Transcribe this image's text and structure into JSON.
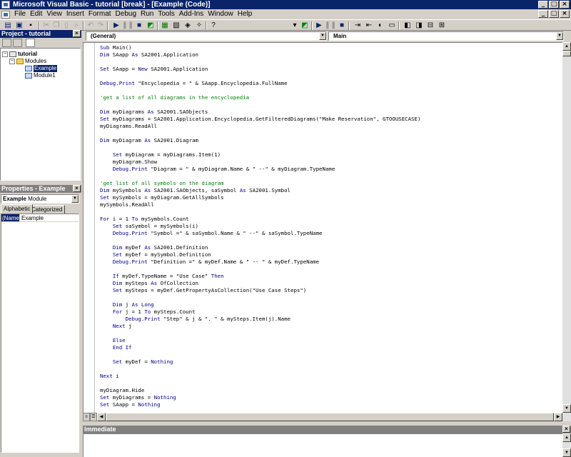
{
  "window": {
    "title": "Microsoft Visual Basic - tutorial [break] - [Example (Code)]",
    "controls": {
      "minimize": "_",
      "restore": "□",
      "close": "×"
    }
  },
  "menu": [
    "File",
    "Edit",
    "View",
    "Insert",
    "Format",
    "Debug",
    "Run",
    "Tools",
    "Add-Ins",
    "Window",
    "Help"
  ],
  "project": {
    "title": "Project - tutorial",
    "tree": {
      "root": "tutorial",
      "folder": "Modules",
      "modules": [
        "Example",
        "Module1"
      ],
      "selected": "Example"
    }
  },
  "properties": {
    "title": "Properties - Example",
    "object_name": "Example",
    "object_type": "Module",
    "tabs": [
      "Alphabetic",
      "Categorized"
    ],
    "active_tab": "Alphabetic",
    "rows": [
      {
        "name": "(Name)",
        "value": "Example"
      }
    ]
  },
  "code_window": {
    "object_combo": "(General)",
    "procedure_combo": "Main",
    "lines": [
      [
        [
          "k",
          "Sub"
        ],
        [
          "t",
          " Main()"
        ]
      ],
      [
        [
          "k",
          "Dim"
        ],
        [
          "t",
          " SAapp "
        ],
        [
          "k",
          "As"
        ],
        [
          "t",
          " SA2001.Application"
        ]
      ],
      [],
      [
        [
          "k",
          "Set"
        ],
        [
          "t",
          " SAapp = "
        ],
        [
          "k",
          "New"
        ],
        [
          "t",
          " SA2001.Application"
        ]
      ],
      [],
      [
        [
          "k",
          "Debug.Print"
        ],
        [
          "t",
          " \"Encyclopedia = \" & SAapp.Encyclopedia.FullName"
        ]
      ],
      [],
      [
        [
          "c",
          "'get a list of all diagrams in the encyclopedia"
        ]
      ],
      [],
      [
        [
          "k",
          "Dim"
        ],
        [
          "t",
          " myDiagrams "
        ],
        [
          "k",
          "As"
        ],
        [
          "t",
          " SA2001.SAObjects"
        ]
      ],
      [
        [
          "k",
          "Set"
        ],
        [
          "t",
          " myDiagrams = SA2001.Application.Encyclopedia.GetFilteredDiagrams(\"Make Reservation\", GTOOUSECASE)"
        ]
      ],
      [
        [
          "t",
          "myDiagrams.ReadAll"
        ]
      ],
      [],
      [
        [
          "k",
          "Dim"
        ],
        [
          "t",
          " myDiagram "
        ],
        [
          "k",
          "As"
        ],
        [
          "t",
          " SA2001.Diagram"
        ]
      ],
      [],
      [
        [
          "t",
          "    "
        ],
        [
          "k",
          "Set"
        ],
        [
          "t",
          " myDiagram = myDiagrams.Item(1)"
        ]
      ],
      [
        [
          "t",
          "    myDiagram.Show"
        ]
      ],
      [
        [
          "t",
          "    "
        ],
        [
          "k",
          "Debug.Print"
        ],
        [
          "t",
          " \"Diagram = \" & myDiagram.Name & \" --\" & myDiagram.TypeName"
        ]
      ],
      [],
      [
        [
          "c",
          "'get list of all symbols on the diagram"
        ]
      ],
      [
        [
          "k",
          "Dim"
        ],
        [
          "t",
          " mySymbols "
        ],
        [
          "k",
          "As"
        ],
        [
          "t",
          " SA2001.SAObjects, saSymbol "
        ],
        [
          "k",
          "As"
        ],
        [
          "t",
          " SA2001.Symbol"
        ]
      ],
      [
        [
          "k",
          "Set"
        ],
        [
          "t",
          " mySymbols = myDiagram.GetAllSymbols"
        ]
      ],
      [
        [
          "t",
          "mySymbols.ReadAll"
        ]
      ],
      [],
      [
        [
          "k",
          "For"
        ],
        [
          "t",
          " i = 1 "
        ],
        [
          "k",
          "To"
        ],
        [
          "t",
          " mySymbols.Count"
        ]
      ],
      [
        [
          "t",
          "    "
        ],
        [
          "k",
          "Set"
        ],
        [
          "t",
          " saSymbol = mySymbols(i)"
        ]
      ],
      [
        [
          "t",
          "    "
        ],
        [
          "k",
          "Debug.Print"
        ],
        [
          "t",
          " \"Symbol =\" & saSymbol.Name & \" --\" & saSymbol.TypeName"
        ]
      ],
      [],
      [
        [
          "t",
          "    "
        ],
        [
          "k",
          "Dim"
        ],
        [
          "t",
          " myDef "
        ],
        [
          "k",
          "As"
        ],
        [
          "t",
          " SA2001.Definition"
        ]
      ],
      [
        [
          "t",
          "    "
        ],
        [
          "k",
          "Set"
        ],
        [
          "t",
          " myDef = mySymbol.Definition"
        ]
      ],
      [
        [
          "t",
          "    "
        ],
        [
          "k",
          "Debug.Print"
        ],
        [
          "t",
          " \"Definition =\" & myDef.Name & \" -- \" & myDef.TypeName"
        ]
      ],
      [],
      [
        [
          "t",
          "    "
        ],
        [
          "k",
          "If"
        ],
        [
          "t",
          " myDef.TypeName = \"Use Case\" "
        ],
        [
          "k",
          "Then"
        ]
      ],
      [
        [
          "t",
          "    "
        ],
        [
          "k",
          "Dim"
        ],
        [
          "t",
          " mySteps "
        ],
        [
          "k",
          "As"
        ],
        [
          "t",
          " OfCollection"
        ]
      ],
      [
        [
          "t",
          "    "
        ],
        [
          "k",
          "Set"
        ],
        [
          "t",
          " mySteps = myDef.GetPropertyAsCollection(\"Use Case Steps\")"
        ]
      ],
      [],
      [
        [
          "t",
          "    "
        ],
        [
          "k",
          "Dim"
        ],
        [
          "t",
          " j "
        ],
        [
          "k",
          "As Long"
        ]
      ],
      [
        [
          "t",
          "    "
        ],
        [
          "k",
          "For"
        ],
        [
          "t",
          " j = 1 "
        ],
        [
          "k",
          "To"
        ],
        [
          "t",
          " mySteps.Count"
        ]
      ],
      [
        [
          "t",
          "        "
        ],
        [
          "k",
          "Debug.Print"
        ],
        [
          "t",
          " \"Step\" & j & \". \" & mySteps.Item(j).Name"
        ]
      ],
      [
        [
          "t",
          "    "
        ],
        [
          "k",
          "Next"
        ],
        [
          "t",
          " j"
        ]
      ],
      [],
      [
        [
          "t",
          "    "
        ],
        [
          "k",
          "Else"
        ]
      ],
      [
        [
          "t",
          "    "
        ],
        [
          "k",
          "End If"
        ]
      ],
      [],
      [
        [
          "t",
          "    "
        ],
        [
          "k",
          "Set"
        ],
        [
          "t",
          " myDef = "
        ],
        [
          "k",
          "Nothing"
        ]
      ],
      [],
      [
        [
          "k",
          "Next"
        ],
        [
          "t",
          " i"
        ]
      ],
      [],
      [
        [
          "t",
          "myDiagram.Hide"
        ]
      ],
      [
        [
          "k",
          "Set"
        ],
        [
          "t",
          " myDiagrams = "
        ],
        [
          "k",
          "Nothing"
        ]
      ],
      [
        [
          "k",
          "Set"
        ],
        [
          "t",
          " SAapp = "
        ],
        [
          "k",
          "Nothing"
        ]
      ]
    ]
  },
  "immediate": {
    "title": "Immediate"
  },
  "icons": {
    "toolbar_left": [
      "view-host-icon",
      "insert-module-icon",
      "save-icon",
      "cut-icon",
      "copy-icon",
      "paste-icon",
      "find-icon",
      "undo-icon",
      "redo-icon",
      "run-icon",
      "break-icon",
      "reset-icon",
      "design-mode-icon",
      "project-explorer-icon",
      "properties-icon",
      "object-browser-icon",
      "toolbox-icon",
      "help-icon"
    ],
    "toolbar_right": [
      "toolbar-options-icon",
      "design-icon",
      "run-icon",
      "break-icon",
      "reset-icon",
      "indent-icon",
      "outdent-icon",
      "toggle-breakpoint-icon",
      "comment-icon",
      "uncomment-icon",
      "bookmark-icon",
      "next-bookmark-icon",
      "prev-bookmark-icon",
      "clear-bookmarks-icon"
    ]
  },
  "colors": {
    "keyword": "#000080",
    "comment": "#008000",
    "titlebar": "#0a246a"
  }
}
